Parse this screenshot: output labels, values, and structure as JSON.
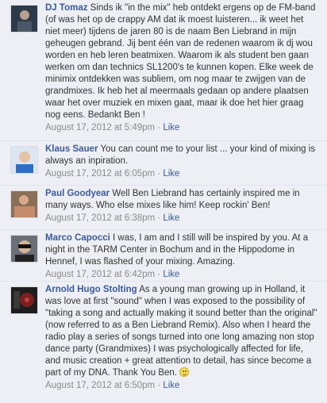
{
  "comments": [
    {
      "author": "DJ Tomaz",
      "text": "Sinds ik \"in the mix\" heb ontdekt ergens op de FM-band (of was het op de crappy AM dat ik moest luisteren... ik weet het niet meer) tijdens de jaren 80 is de naam Ben Liebrand in mijn geheugen gebrand. Jij bent één van de redenen waarom ik dj wou worden en heb leren beatmixen. Waarom ik als student ben gaan werken om dan technics SL1200's te kunnen kopen. Elke week de minimix ontdekken was subliem, om nog maar te zwijgen van de grandmixes. Ik heb het al meermaals gedaan op andere plaatsen waar het over muziek en mixen gaat, maar ik doe het hier graag nog eens. Bedankt Ben !",
      "timestamp": "August 17, 2012 at 5:49pm",
      "separator": "·",
      "like": "Like",
      "avatar_icon": "user-photo-icon"
    },
    {
      "author": "Klaus Sauer",
      "text": "You can count me to your list ... your kind of mixing is always an inpiration.",
      "timestamp": "August 17, 2012 at 6:05pm",
      "separator": "·",
      "like": "Like",
      "avatar_icon": "user-photo-icon"
    },
    {
      "author": "Paul Goodyear",
      "text": "Well Ben Liebrand has certainly inspired me in many ways. Who else mixes like him! Keep rockin' Ben!",
      "timestamp": "August 17, 2012 at 6:38pm",
      "separator": "·",
      "like": "Like",
      "avatar_icon": "user-photo-icon"
    },
    {
      "author": "Marco Capocci",
      "text": "I was, I am and I still will be inspired by you. At a night in the TARM Center in Bochum and in the Hippodome in Hennef, I was flashed of your mixing. Amazing.",
      "timestamp": "August 17, 2012 at 6:42pm",
      "separator": "·",
      "like": "Like",
      "avatar_icon": "user-photo-icon"
    },
    {
      "author": "Arnold Hugo Stolting",
      "text": "As a young man growing up in Holland, it was love at first \"sound\" when I was exposed to the possibility of \"taking a song and actually making it sound better than the original\" (now referred to as a Ben Liebrand Remix). Also when I heard the radio play a series of songs turned into one long amazing non stop dance party (Grandmixes) I was psychologically affected for life, and music creation + great attention to detail, has since become a part of my DNA. Thank You Ben.",
      "timestamp": "August 17, 2012 at 6:50pm",
      "separator": "·",
      "like": "Like",
      "avatar_icon": "user-photo-icon",
      "emoji_icon": "smiley-icon"
    }
  ],
  "colors": {
    "background": "#edeff4",
    "link": "#3b5998",
    "text": "#333333",
    "meta": "#8a8a8a"
  }
}
